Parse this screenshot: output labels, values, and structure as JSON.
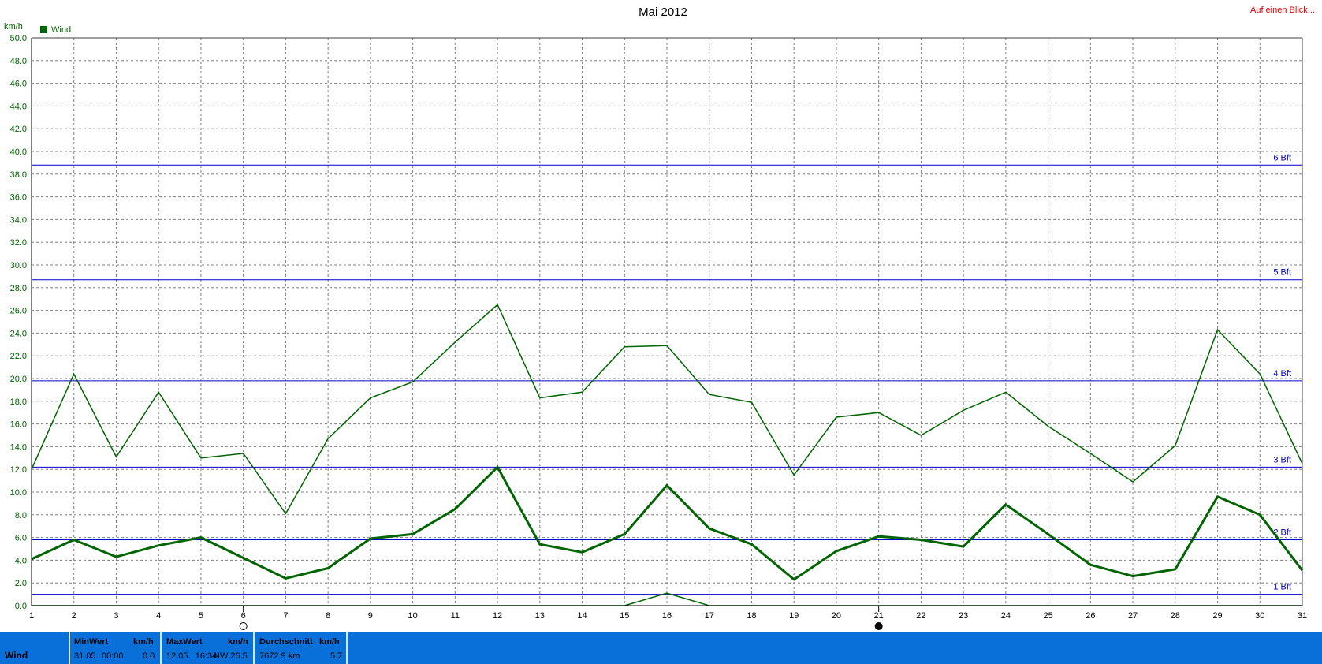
{
  "header": {
    "title": "Mai 2012",
    "link": "Auf einen Blick ...",
    "unit": "km/h"
  },
  "legend": {
    "label": "Wind",
    "color": "#006400"
  },
  "chart_data": {
    "type": "line",
    "title": "Mai 2012",
    "ylabel": "km/h",
    "xlabel": "",
    "ylim": [
      0,
      50
    ],
    "xlim": [
      1,
      31
    ],
    "grid": true,
    "legend_position": "top-left",
    "y_ticks": [
      "0.0",
      "2.0",
      "4.0",
      "6.0",
      "8.0",
      "10.0",
      "12.0",
      "14.0",
      "16.0",
      "18.0",
      "20.0",
      "22.0",
      "24.0",
      "26.0",
      "28.0",
      "30.0",
      "32.0",
      "34.0",
      "36.0",
      "38.0",
      "40.0",
      "42.0",
      "44.0",
      "46.0",
      "48.0",
      "50.0"
    ],
    "x": [
      1,
      2,
      3,
      4,
      5,
      6,
      7,
      8,
      9,
      10,
      11,
      12,
      13,
      14,
      15,
      16,
      17,
      18,
      19,
      20,
      21,
      22,
      23,
      24,
      25,
      26,
      27,
      28,
      29,
      30,
      31
    ],
    "series": [
      {
        "name": "Wind",
        "color": "#006400",
        "width": 1.5,
        "values": [
          12.0,
          20.4,
          13.1,
          18.8,
          13.0,
          13.4,
          8.1,
          14.7,
          18.3,
          19.7,
          23.2,
          26.5,
          18.3,
          18.8,
          22.8,
          22.9,
          18.6,
          17.9,
          11.5,
          16.6,
          17.0,
          15.0,
          17.2,
          18.8,
          15.8,
          13.4,
          10.9,
          14.1,
          24.3,
          20.4,
          12.5
        ]
      },
      {
        "name": "Wind",
        "color": "#006400",
        "width": 3,
        "values": [
          4.1,
          5.8,
          4.3,
          5.3,
          6.0,
          4.2,
          2.4,
          3.3,
          5.9,
          6.3,
          8.5,
          12.2,
          5.4,
          4.7,
          6.3,
          10.6,
          6.8,
          5.4,
          2.3,
          4.8,
          6.1,
          5.8,
          5.2,
          8.9,
          6.3,
          3.6,
          2.6,
          3.2,
          9.6,
          8.0,
          3.1
        ]
      },
      {
        "name": "Wind",
        "color": "#006400",
        "width": 1.5,
        "values": [
          0.0,
          0.0,
          0.0,
          0.0,
          0.0,
          0.0,
          0.0,
          0.0,
          0.0,
          0.0,
          0.0,
          0.0,
          0.0,
          0.0,
          0.0,
          1.1,
          0.0,
          0.0,
          0.0,
          0.0,
          0.0,
          0.0,
          0.0,
          0.0,
          0.0,
          0.0,
          0.0,
          0.0,
          0.0,
          0.0,
          0.0
        ]
      }
    ],
    "reference_lines": [
      {
        "label": "1 Bft",
        "value": 1.0
      },
      {
        "label": "2 Bft",
        "value": 5.8
      },
      {
        "label": "3 Bft",
        "value": 12.2
      },
      {
        "label": "4 Bft",
        "value": 19.8
      },
      {
        "label": "5 Bft",
        "value": 28.7
      },
      {
        "label": "6 Bft",
        "value": 38.8
      }
    ],
    "reference_color": "#0000cc",
    "moon_markers": [
      {
        "day": 6,
        "phase": "full"
      },
      {
        "day": 21,
        "phase": "new"
      }
    ]
  },
  "stats": {
    "row_label": "Wind",
    "min": {
      "header": "MinWert",
      "unit": "km/h",
      "date": "31.05.",
      "time": "00:00",
      "value": "0.0"
    },
    "max": {
      "header": "MaxWert",
      "unit": "km/h",
      "datetime": "12.05.  16:34",
      "dir_value": "NW 26.5"
    },
    "avg": {
      "header": "Durchschnitt",
      "unit": "km/h",
      "distance": "7672.9 km",
      "value": "5.7"
    }
  }
}
